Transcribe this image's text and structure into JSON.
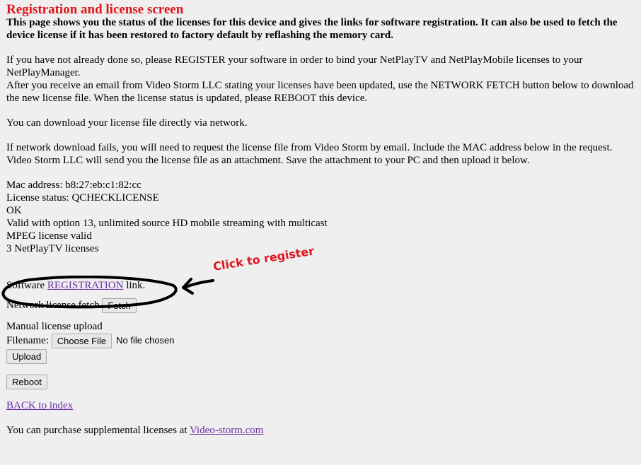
{
  "page": {
    "title": "Registration and license screen",
    "intro": "This page shows you the status of the licenses for this device and gives the links for software registration. It can also be used to fetch the device license if it has been restored to factory default by reflashing the memory card.",
    "para1_line1": "If you have not already done so, please REGISTER your software in order to bind your NetPlayTV and NetPlayMobile licenses to your NetPlayManager.",
    "para1_line2": "After you receive an email from Video Storm LLC stating your licenses have been updated, use the NETWORK FETCH button below to download the new license file. When the license status is updated, please REBOOT this device.",
    "para2": "You can download your license file directly via network.",
    "para3_line1": "If network download fails, you will need to request the license file from Video Storm by email. Include the MAC address below in the request.",
    "para3_line2": "Video Storm LLC will send you the license file as an attachment. Save the attachment to your PC and then upload it below."
  },
  "status": {
    "mac": "Mac address: b8:27:eb:c1:82:cc",
    "license_status": "License status: QCHECKLICENSE",
    "ok": "OK",
    "valid": "Valid with option 13, unlimited source HD mobile streaming with multicast",
    "mpeg": "MPEG license valid",
    "netplay": "3 NetPlayTV licenses"
  },
  "registration": {
    "prefix": "Software ",
    "link": "REGISTRATION",
    "suffix": " link."
  },
  "annotation": {
    "text": "Click to register",
    "color": "#e0141b"
  },
  "network_fetch": {
    "label": "Network license fetch ",
    "button": "Fetch"
  },
  "manual_upload": {
    "heading": "Manual license upload",
    "filename_label": "Filename: ",
    "choose_button": "Choose File",
    "no_file": "No file chosen",
    "upload_button": "Upload"
  },
  "reboot_button": "Reboot",
  "back_link": "BACK to index",
  "purchase": {
    "text": "You can purchase supplemental licenses at ",
    "link": "Video-storm.com"
  },
  "colors": {
    "title": "#e0141b",
    "link": "#6b2fa6",
    "background": "#efefef"
  }
}
